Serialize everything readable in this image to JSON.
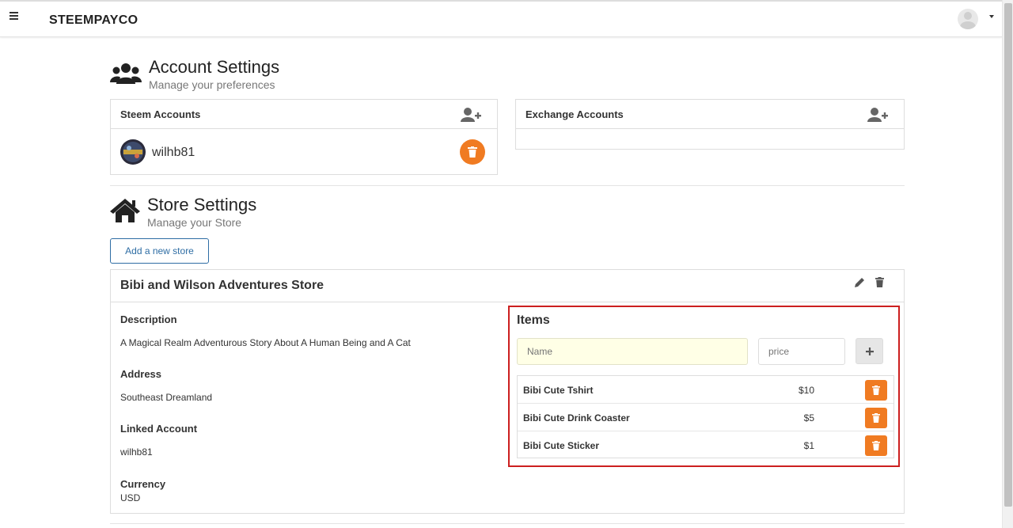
{
  "app": {
    "brand": "STEEMPAYCO"
  },
  "account": {
    "title": "Account Settings",
    "subtitle": "Manage your preferences",
    "steem": {
      "label": "Steem Accounts",
      "username": "wilhb81"
    },
    "exchange": {
      "label": "Exchange Accounts"
    }
  },
  "store": {
    "title": "Store Settings",
    "subtitle": "Manage your Store",
    "add_label": "Add a new store",
    "name": "Bibi and Wilson Adventures Store",
    "fields": {
      "description_label": "Description",
      "description": "A Magical Realm Adventurous Story About A Human Being and A Cat",
      "address_label": "Address",
      "address": "Southeast Dreamland",
      "linked_label": "Linked Account",
      "linked": "wilhb81",
      "currency_label": "Currency",
      "currency": "USD"
    },
    "items": {
      "title": "Items",
      "name_placeholder": "Name",
      "price_placeholder": "price",
      "rows": [
        {
          "name": "Bibi Cute Tshirt",
          "price": "$10"
        },
        {
          "name": "Bibi Cute Drink Coaster",
          "price": "$5"
        },
        {
          "name": "Bibi Cute Sticker",
          "price": "$1"
        }
      ]
    }
  },
  "colors": {
    "accent": "#f07b22",
    "highlight_border": "#cc1f1f",
    "link": "#2e6da4"
  }
}
